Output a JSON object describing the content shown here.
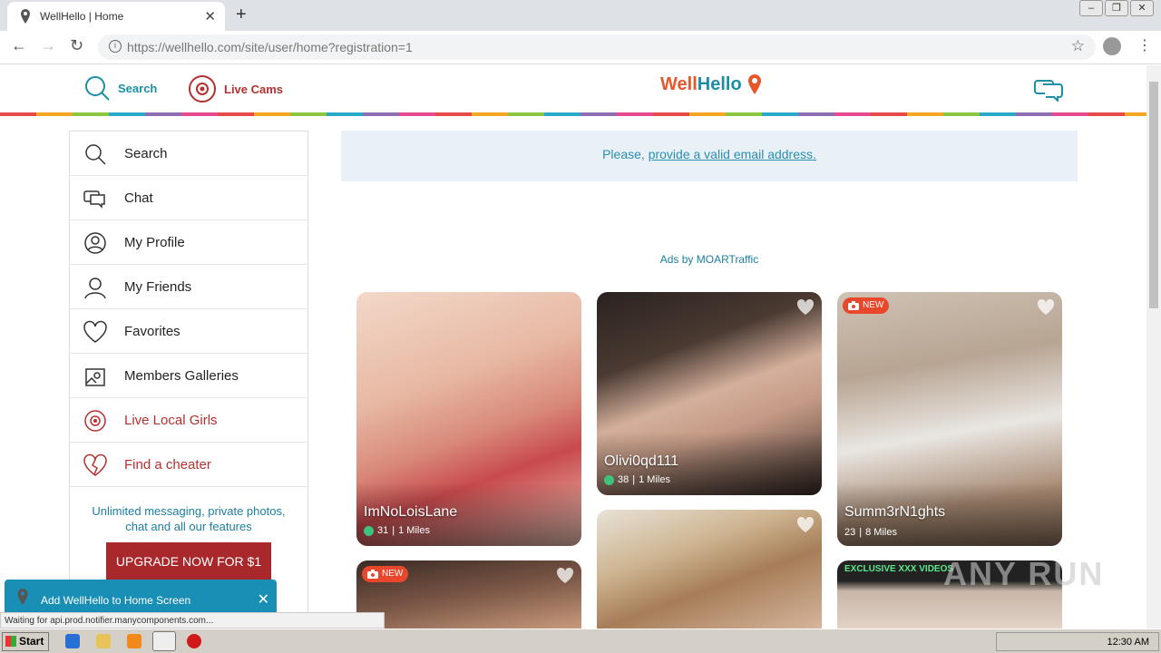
{
  "browser": {
    "tab_title": "WellHello | Home",
    "url": "https://wellhello.com/site/user/home?registration=1"
  },
  "header": {
    "search_label": "Search",
    "livecams_label": "Live Cams",
    "logo_part1": "Well",
    "logo_part2": "Hello"
  },
  "sidebar": {
    "items": [
      {
        "label": "Search"
      },
      {
        "label": "Chat"
      },
      {
        "label": "My Profile"
      },
      {
        "label": "My Friends"
      },
      {
        "label": "Favorites"
      },
      {
        "label": "Members Galleries"
      },
      {
        "label": "Live Local Girls"
      },
      {
        "label": "Find a cheater"
      }
    ],
    "promo_text": "Unlimited messaging, private photos, chat and all our features",
    "upgrade_label": "UPGRADE NOW FOR $1"
  },
  "alert": {
    "prefix": "Please, ",
    "link": "provide a valid email address."
  },
  "ads_label": "Ads by MOARTraffic",
  "cards": [
    {
      "name": "ImNoLoisLane",
      "age": "31",
      "distance": "1 Miles",
      "online": true
    },
    {
      "name": "Olivi0qd111",
      "age": "38",
      "distance": "1 Miles",
      "online": true
    },
    {
      "name": "Summ3rN1ghts",
      "age": "23",
      "distance": "8 Miles",
      "online": false,
      "badge": "NEW"
    },
    {
      "badge": "NEW"
    },
    {},
    {
      "badge": "EXCLUSIVE XXX VIDEOS"
    }
  ],
  "a2h_label": "Add WellHello to Home Screen",
  "status_text": "Waiting for api.prod.notifier.manycomponents.com...",
  "taskbar": {
    "start_label": "Start",
    "clock": "12:30 AM"
  },
  "watermark": "ANY RUN",
  "colors": {
    "brand_teal": "#1a8fa5",
    "brand_red": "#b3312e",
    "upgrade_bg": "#a9282c"
  }
}
